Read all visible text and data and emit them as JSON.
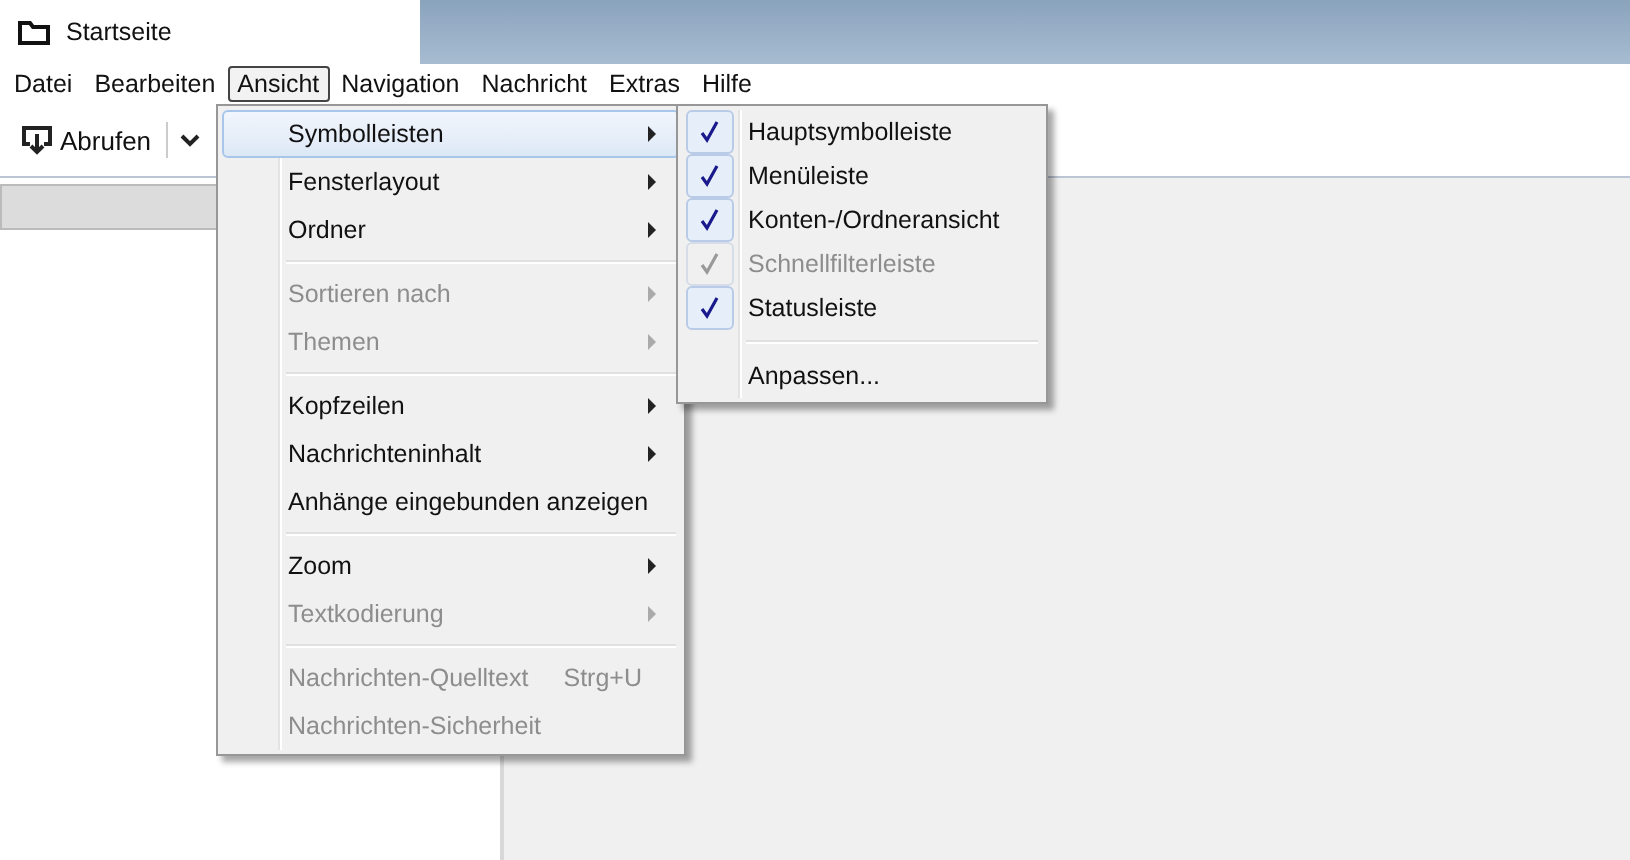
{
  "tab": {
    "title": "Startseite"
  },
  "menubar": [
    {
      "label": "Datei",
      "selected": false
    },
    {
      "label": "Bearbeiten",
      "selected": false
    },
    {
      "label": "Ansicht",
      "selected": true
    },
    {
      "label": "Navigation",
      "selected": false
    },
    {
      "label": "Nachricht",
      "selected": false
    },
    {
      "label": "Extras",
      "selected": false
    },
    {
      "label": "Hilfe",
      "selected": false
    }
  ],
  "toolbar": {
    "get_button": "Abrufen"
  },
  "menu": [
    {
      "kind": "item",
      "label": "Symbolleisten",
      "submenu": true,
      "disabled": false,
      "selected": true
    },
    {
      "kind": "item",
      "label": "Fensterlayout",
      "submenu": true,
      "disabled": false,
      "selected": false
    },
    {
      "kind": "item",
      "label": "Ordner",
      "submenu": true,
      "disabled": false,
      "selected": false
    },
    {
      "kind": "separator"
    },
    {
      "kind": "item",
      "label": "Sortieren nach",
      "submenu": true,
      "disabled": true,
      "selected": false
    },
    {
      "kind": "item",
      "label": "Themen",
      "submenu": true,
      "disabled": true,
      "selected": false
    },
    {
      "kind": "separator"
    },
    {
      "kind": "item",
      "label": "Kopfzeilen",
      "submenu": true,
      "disabled": false,
      "selected": false
    },
    {
      "kind": "item",
      "label": "Nachrichteninhalt",
      "submenu": true,
      "disabled": false,
      "selected": false
    },
    {
      "kind": "item",
      "label": "Anhänge eingebunden anzeigen",
      "submenu": false,
      "disabled": false,
      "selected": false
    },
    {
      "kind": "separator"
    },
    {
      "kind": "item",
      "label": "Zoom",
      "submenu": true,
      "disabled": false,
      "selected": false
    },
    {
      "kind": "item",
      "label": "Textkodierung",
      "submenu": true,
      "disabled": true,
      "selected": false
    },
    {
      "kind": "separator"
    },
    {
      "kind": "item",
      "label": "Nachrichten-Quelltext",
      "shortcut": "Strg+U",
      "submenu": false,
      "disabled": true,
      "selected": false
    },
    {
      "kind": "item",
      "label": "Nachrichten-Sicherheit",
      "submenu": false,
      "disabled": true,
      "selected": false
    }
  ],
  "submenu": [
    {
      "kind": "check",
      "label": "Hauptsymbolleiste",
      "checked": true,
      "disabled": false
    },
    {
      "kind": "check",
      "label": "Menüleiste",
      "checked": true,
      "disabled": false
    },
    {
      "kind": "check",
      "label": "Konten-/Ordneransicht",
      "checked": true,
      "disabled": false
    },
    {
      "kind": "check",
      "label": "Schnellfilterleiste",
      "checked": true,
      "disabled": true
    },
    {
      "kind": "check",
      "label": "Statusleiste",
      "checked": true,
      "disabled": false
    },
    {
      "kind": "separator"
    },
    {
      "kind": "item",
      "label": "Anpassen...",
      "disabled": false
    }
  ]
}
